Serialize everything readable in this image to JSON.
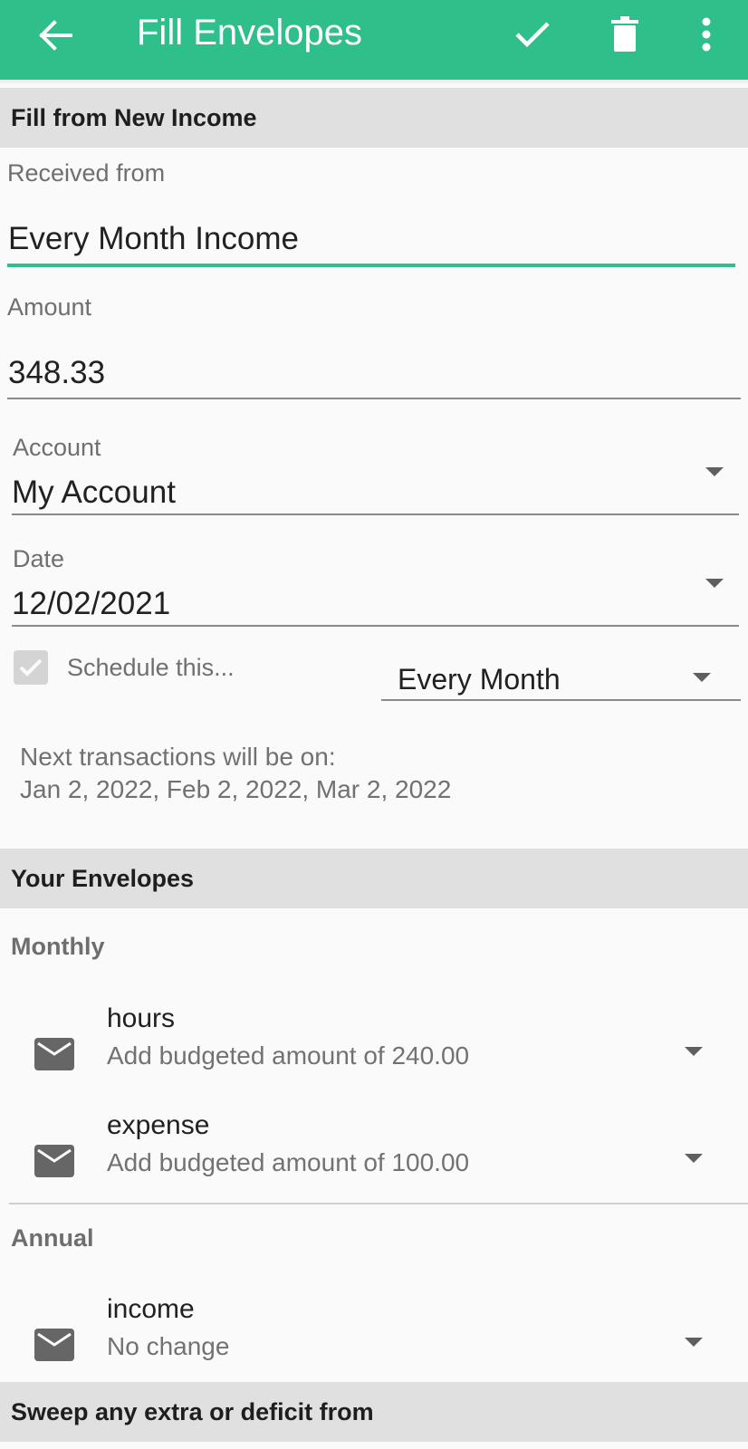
{
  "colors": {
    "accent": "#2fbf8a"
  },
  "appbar": {
    "title": "Fill Envelopes",
    "back_icon": "arrow-left-icon",
    "actions": [
      {
        "icon": "check-icon"
      },
      {
        "icon": "trash-icon"
      },
      {
        "icon": "more-vertical-icon"
      }
    ]
  },
  "income_section": {
    "header": "Fill from New Income",
    "received_from_label": "Received from",
    "received_from_value": "Every Month Income",
    "amount_label": "Amount",
    "amount_value": "348.33",
    "account_label": "Account",
    "account_value": "My Account",
    "date_label": "Date",
    "date_value": "12/02/2021",
    "schedule_label": "Schedule this...",
    "schedule_checked": true,
    "schedule_frequency": "Every Month",
    "next_label": "Next transactions will be on:",
    "next_dates": "Jan 2, 2022, Feb 2, 2022, Mar 2, 2022"
  },
  "envelopes_section": {
    "header": "Your Envelopes",
    "groups": [
      {
        "label": "Monthly",
        "items": [
          {
            "name": "hours",
            "subtitle": "Add budgeted amount of 240.00"
          },
          {
            "name": "expense",
            "subtitle": "Add budgeted amount of 100.00"
          }
        ]
      },
      {
        "label": "Annual",
        "items": [
          {
            "name": "income",
            "subtitle": "No change"
          }
        ]
      }
    ]
  },
  "sweep_section": {
    "header": "Sweep any extra or deficit from"
  }
}
